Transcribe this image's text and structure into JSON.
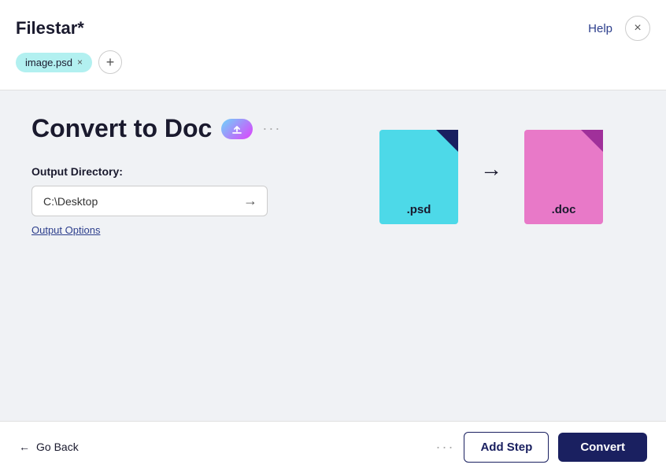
{
  "header": {
    "logo": "Filestar*",
    "help_label": "Help",
    "close_label": "×",
    "tab": {
      "label": "image.psd",
      "close": "×"
    },
    "add_tab_label": "+"
  },
  "main": {
    "page_title": "Convert to Doc",
    "upload_icon": "↑",
    "more_icon": "···",
    "output_directory_label": "Output Directory:",
    "directory_value": "C:\\Desktop",
    "directory_arrow": "→",
    "output_options_label": "Output Options"
  },
  "conversion": {
    "from_ext": ".psd",
    "to_ext": ".doc",
    "arrow": "→"
  },
  "footer": {
    "go_back_label": "Go Back",
    "more_label": "···",
    "add_step_label": "Add Step",
    "convert_label": "Convert"
  }
}
